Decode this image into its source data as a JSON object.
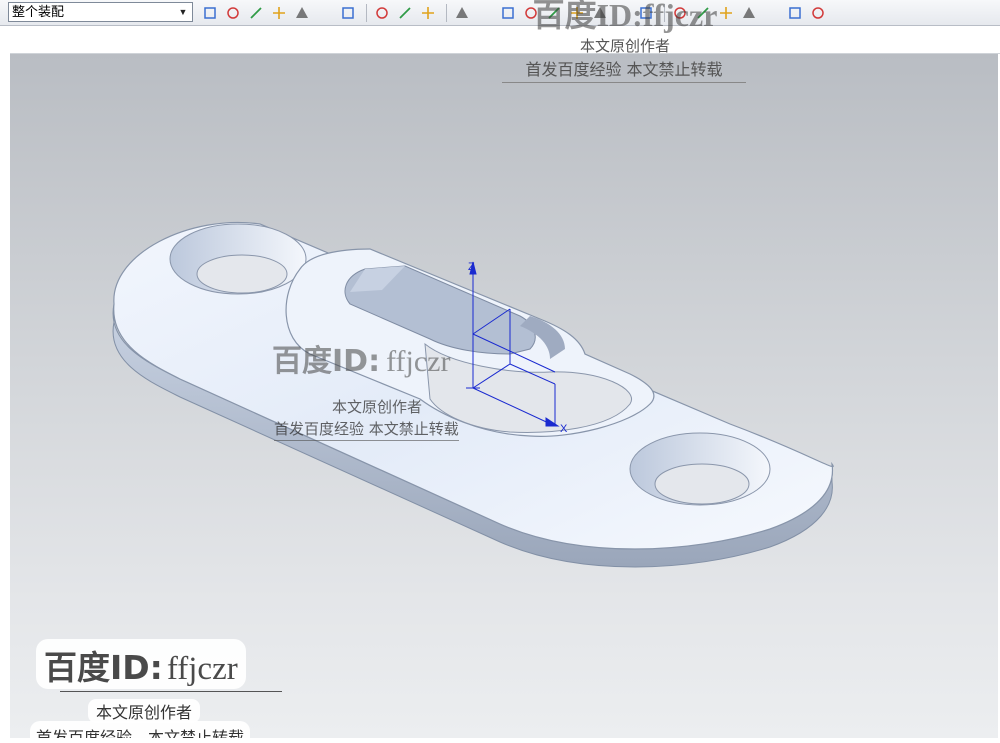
{
  "toolbar": {
    "assembly_selector": "整个装配",
    "icons": [
      "filter-icon",
      "move-icon",
      "snap-icon",
      "plus-icon",
      "point-icon",
      "target-icon",
      "constraint-icon",
      "render-icon",
      "cube-icon",
      "component-icon",
      "line-icon",
      "sketch-icon",
      "curve-icon",
      "arc-icon",
      "circle-icon",
      "spline-icon",
      "point-constructor-icon",
      "trim-icon",
      "extend-icon",
      "view-icon",
      "fit-icon",
      "rotate-icon",
      "shade-icon",
      "render-style-icon",
      "layer-icon",
      "camera-icon"
    ]
  },
  "watermark": {
    "id_prefix": "百度ID:",
    "id_suffix": "ffjczr",
    "line1": "本文原创作者",
    "line2": "首发百度经验  本文禁止转载",
    "line2_alt": "首发百度经验，本文禁止转载"
  },
  "viewport": {
    "axis_x": "X",
    "axis_z": "Z",
    "colors": {
      "background_top": "#b9bdc3",
      "background_bottom": "#eceef0",
      "part_face": "#e6eefa",
      "part_edge": "#8895aa",
      "axis": "#1a2ad0"
    }
  }
}
